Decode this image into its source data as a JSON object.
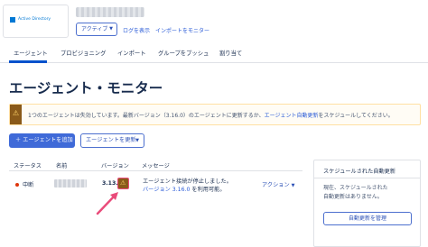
{
  "header": {
    "logo_text": "Active Directory",
    "status_dropdown": "アクティブ",
    "links": [
      "ログを表示",
      "インポートをモニター"
    ]
  },
  "tabs": [
    {
      "label": "エージェント",
      "active": true
    },
    {
      "label": "プロビジョニング",
      "active": false
    },
    {
      "label": "インポート",
      "active": false
    },
    {
      "label": "グループをプッシュ",
      "active": false
    },
    {
      "label": "割り当て",
      "active": false
    }
  ],
  "page_title": "エージェント・モニター",
  "banner": {
    "text": "1つのエージェントは失効しています。最新バージョン（3.16.0）のエージェントに更新するか、",
    "link": "エージェント自動更新",
    "text_after": "をスケジュールしてください。",
    "icon": "warning-icon"
  },
  "buttons": {
    "add_agent": "＋ エージェントを追加",
    "update_agent": "エージェントを更新"
  },
  "table": {
    "headers": [
      "ステータス",
      "名前",
      "バージョン",
      "メッセージ"
    ],
    "rows": [
      {
        "status": "中断",
        "status_color": "#de350b",
        "version": "3.13.",
        "message_line1": "エージェント接続が停止しました。",
        "message_link": "バージョン 3.16.0",
        "message_after": " を利用可能。",
        "action": "アクション"
      }
    ]
  },
  "panel": {
    "title": "スケジュールされた自動更新",
    "body_line1": "現在、スケジュールされた",
    "body_line2": "自動更新はありません。",
    "button": "自動更新を管理"
  },
  "colors": {
    "primary": "#3f6ad8",
    "link": "#2a5bd7",
    "warning_bg": "#8a5a1a",
    "annotation_arrow": "#e94b7a"
  }
}
